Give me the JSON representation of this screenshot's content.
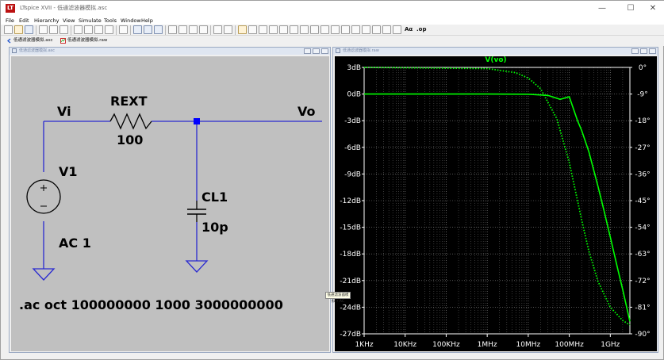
{
  "window": {
    "app_icon_text": "LT",
    "title": "LTspice XVII - 低通滤波器模拟.asc",
    "minimize": "—",
    "maximize": "☐",
    "close": "✕"
  },
  "menu": [
    "File",
    "Edit",
    "Hierarchy",
    "View",
    "Simulate",
    "Tools",
    "Window",
    "Help"
  ],
  "toolbar": {
    "ac_label": "Aα",
    "op_label": ".op"
  },
  "tabs": [
    {
      "label": "低通滤波器模拟.asc"
    },
    {
      "label": "低通滤波器模拟.raw"
    }
  ],
  "schematic": {
    "window_title": "低通滤波器模拟.asc",
    "net_vi": "Vi",
    "net_vo": "Vo",
    "resistor_name": "REXT",
    "resistor_value": "100",
    "source_name": "V1",
    "source_value": "AC 1",
    "cap_name": "CL1",
    "cap_value": "10p",
    "directive": ".ac oct 100000000 1000 3000000000",
    "wire_color": "#2a2ad0",
    "junction_color": "#0000ff"
  },
  "tooltip": "低通滤波器模拟 • AC",
  "plot_window": {
    "window_title": "低通滤波器模拟.raw"
  },
  "chart_data": {
    "type": "line",
    "title": "V(vo)",
    "xlabel": "",
    "ylabel": "",
    "x_scale": "log",
    "x_ticks": [
      "1KHz",
      "10KHz",
      "100KHz",
      "1MHz",
      "10MHz",
      "100MHz",
      "1GHz"
    ],
    "y_ticks_left": [
      "3dB",
      "0dB",
      "-3dB",
      "-6dB",
      "-9dB",
      "-12dB",
      "-15dB",
      "-18dB",
      "-21dB",
      "-24dB",
      "-27dB"
    ],
    "y_ticks_right": [
      "0°",
      "-9°",
      "-18°",
      "-27°",
      "-36°",
      "-45°",
      "-54°",
      "-63°",
      "-72°",
      "-81°",
      "-90°"
    ],
    "xlim": [
      1000,
      3000000000
    ],
    "ylim_left_db": [
      -27,
      3
    ],
    "ylim_right_deg": [
      -90,
      0
    ],
    "grid": true,
    "color": "#00ff00",
    "series": [
      {
        "name": "V(vo)",
        "quantity": "magnitude_db",
        "style": "solid",
        "x": [
          1000,
          1000000,
          10000000,
          30000000,
          60000000,
          100000000,
          159000000,
          200000000,
          300000000,
          500000000,
          700000000,
          1000000000,
          1500000000,
          2000000000,
          3000000000
        ],
        "y": [
          0,
          0,
          -0.02,
          -0.15,
          -0.6,
          -0.3,
          -3.0,
          -4.1,
          -6.5,
          -10.4,
          -13.1,
          -16.1,
          -19.6,
          -22.0,
          -25.6
        ]
      },
      {
        "name": "V(vo) phase",
        "quantity": "phase_deg",
        "style": "dotted",
        "x": [
          1000,
          1000000,
          5000000,
          10000000,
          20000000,
          50000000,
          100000000,
          159000000,
          200000000,
          300000000,
          500000000,
          1000000000,
          2000000000,
          3000000000
        ],
        "y": [
          0,
          -0.4,
          -1.8,
          -3.6,
          -7.2,
          -17.4,
          -32.1,
          -45.0,
          -51.5,
          -62.1,
          -72.3,
          -81.0,
          -85.5,
          -87.0
        ]
      }
    ]
  }
}
